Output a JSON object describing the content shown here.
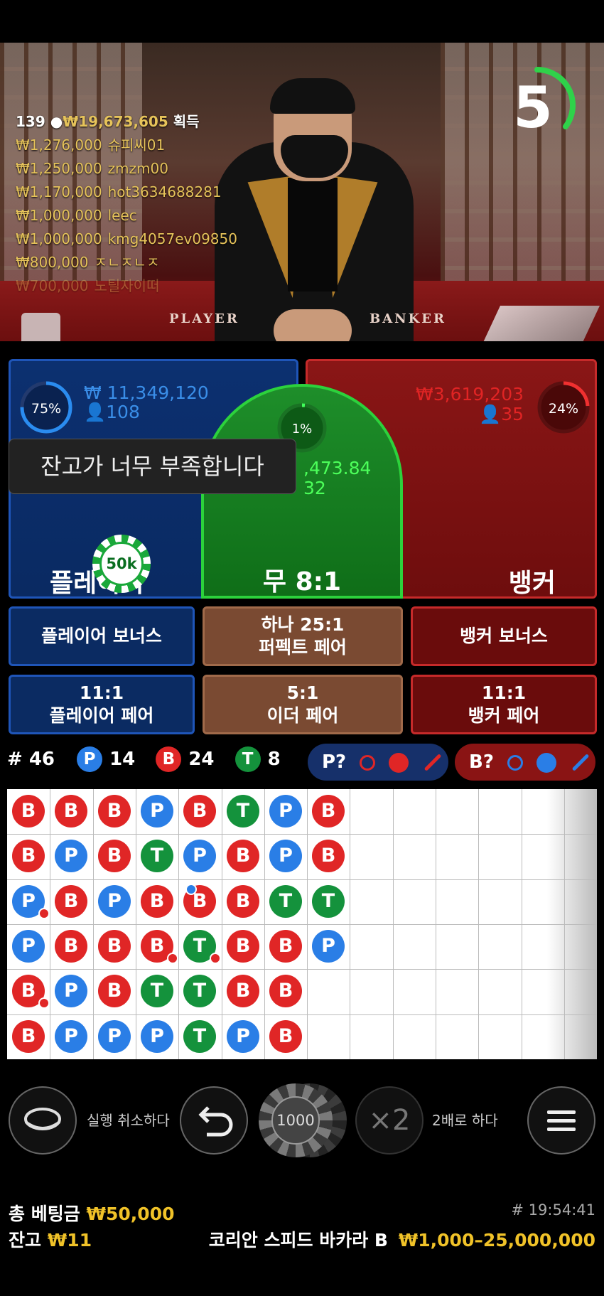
{
  "video": {
    "table_player_label": "PLAYER",
    "table_banker_label": "BANKER",
    "countdown": "5",
    "winners_header": {
      "count": "139",
      "amount": "₩19,673,605",
      "suffix": "획득"
    },
    "winners": [
      {
        "amount": "₩1,276,000",
        "name": "슈피씨01"
      },
      {
        "amount": "₩1,250,000",
        "name": "zmzm00"
      },
      {
        "amount": "₩1,170,000",
        "name": "hot3634688281"
      },
      {
        "amount": "₩1,000,000",
        "name": "leec"
      },
      {
        "amount": "₩1,000,000",
        "name": "kmg4057ev09850"
      },
      {
        "amount": "₩800,000",
        "name": "ㅈㄴㅈㄴㅈ"
      },
      {
        "amount": "₩700,000",
        "name": "노틸자이떠"
      }
    ]
  },
  "bets": {
    "player": {
      "percent": "75%",
      "percent_value": 75,
      "amount": "₩ 11,349,120",
      "players": "108",
      "label": "플레이어"
    },
    "tie": {
      "percent": "1%",
      "percent_value": 1,
      "amount": ",473.84",
      "players": "32",
      "label": "무 8:1"
    },
    "banker": {
      "percent": "24%",
      "percent_value": 24,
      "amount": "₩3,619,203",
      "players": "35",
      "label": "뱅커"
    },
    "toast": "잔고가 너무 부족합니다",
    "placed_chip": "50k"
  },
  "side_bets": {
    "player_bonus": "플레이어 보너스",
    "perfect_pair_odds": "하나 25:1",
    "perfect_pair": "퍼펙트 페어",
    "banker_bonus": "뱅커 보너스",
    "player_pair_odds": "11:1",
    "player_pair": "플레이어 페어",
    "either_pair_odds": "5:1",
    "either_pair": "이더 페어",
    "banker_pair_odds": "11:1",
    "banker_pair": "뱅커 페어"
  },
  "stats": {
    "round": "# 46",
    "p_letter": "P",
    "p_count": "14",
    "b_letter": "B",
    "b_count": "24",
    "t_letter": "T",
    "t_count": "8",
    "player_predict": "P?",
    "banker_predict": "B?"
  },
  "road": {
    "columns": [
      [
        "B",
        "B",
        "P",
        "P",
        "B",
        "B"
      ],
      [
        "B",
        "P",
        "B",
        "B",
        "P",
        "P"
      ],
      [
        "B",
        "B",
        "P",
        "B",
        "B",
        "P"
      ],
      [
        "P",
        "T",
        "B",
        "B",
        "T",
        "P"
      ],
      [
        "B",
        "P",
        "B",
        "T",
        "T",
        "T"
      ],
      [
        "T",
        "B",
        "B",
        "B",
        "B",
        "P"
      ],
      [
        "P",
        "P",
        "T",
        "B",
        "B",
        "B"
      ],
      [
        "B",
        "B",
        "T",
        "P"
      ]
    ],
    "markers": [
      {
        "col": 0,
        "row": 2,
        "type": "b"
      },
      {
        "col": 0,
        "row": 4,
        "type": "b"
      },
      {
        "col": 3,
        "row": 3,
        "type": "b"
      },
      {
        "col": 4,
        "row": 2,
        "type": "p"
      },
      {
        "col": 4,
        "row": 3,
        "type": "b"
      }
    ]
  },
  "controls": {
    "undo_text": "실행 취소하다",
    "chip_value": "1000",
    "double_symbol": "×2",
    "double_text": "2배로 하다"
  },
  "footer": {
    "total_bet_label": "총 베팅금",
    "total_bet": "₩50,000",
    "balance_label": "잔고",
    "balance": "₩11",
    "time": "# 19:54:41",
    "table_name": "코리안 스피드 바카라 B",
    "limits": "₩1,000–25,000,000"
  },
  "colors": {
    "player": "#1f55b8",
    "banker": "#c62a2a",
    "tie": "#2cd23c",
    "gold": "#f0c228"
  }
}
